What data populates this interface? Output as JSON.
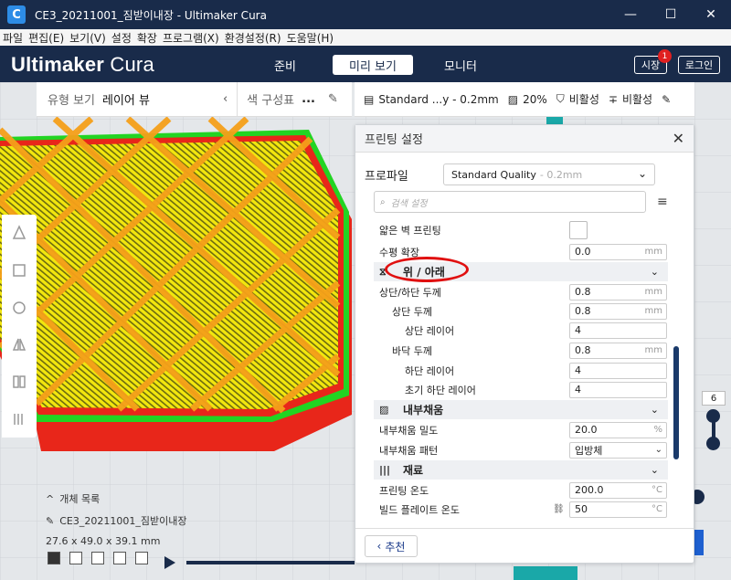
{
  "window": {
    "title": "CE3_20211001_짐받이내장 - Ultimaker Cura",
    "app_icon": "C",
    "controls": [
      "—",
      "☐",
      "✕"
    ]
  },
  "menu": [
    "파일",
    "편집(E)",
    "보기(V)",
    "설정",
    "확장",
    "프로그램(X)",
    "환경설정(R)",
    "도움말(H)"
  ],
  "header": {
    "logo_main": "Ultimaker",
    "logo_sub": "Cura",
    "tabs": [
      "준비",
      "미리 보기",
      "모니터"
    ],
    "active_tab": "미리 보기",
    "marketplace_label": "시장",
    "marketplace_badge": "1",
    "login_label": "로그인"
  },
  "viewbar": {
    "view_type_label": "유형 보기",
    "view_type_value": "레이어 뷰",
    "color_scheme_label": "색 구성표",
    "color_scheme_value": "..."
  },
  "printbar": {
    "profile": "Standard ...y - 0.2mm",
    "infill": "20%",
    "support": "비활성",
    "adhesion": "비활성"
  },
  "panel": {
    "title": "프린팅 설정",
    "profile_label": "프로파일",
    "profile_value": "Standard Quality",
    "profile_sub": "- 0.2mm",
    "search_placeholder": "검색 설정",
    "recommend_label": "추천",
    "settings": [
      {
        "kind": "check",
        "label": "얇은 벽 프린팅",
        "indent": 0
      },
      {
        "kind": "field",
        "label": "수평 확장",
        "value": "0.0",
        "unit": "mm",
        "indent": 0
      },
      {
        "kind": "cat",
        "label": "위 / 아래",
        "icon": "⧖"
      },
      {
        "kind": "field",
        "label": "상단/하단 두께",
        "value": "0.8",
        "unit": "mm",
        "indent": 0
      },
      {
        "kind": "field",
        "label": "상단 두께",
        "value": "0.8",
        "unit": "mm",
        "indent": 1
      },
      {
        "kind": "field",
        "label": "상단 레이어",
        "value": "4",
        "unit": "",
        "indent": 2
      },
      {
        "kind": "field",
        "label": "바닥 두께",
        "value": "0.8",
        "unit": "mm",
        "indent": 1
      },
      {
        "kind": "field",
        "label": "하단 레이어",
        "value": "4",
        "unit": "",
        "indent": 2
      },
      {
        "kind": "field",
        "label": "초기 하단 레이어",
        "value": "4",
        "unit": "",
        "indent": 2
      },
      {
        "kind": "cat",
        "label": "내부채움",
        "icon": "▨"
      },
      {
        "kind": "field",
        "label": "내부채움 밀도",
        "value": "20.0",
        "unit": "%",
        "indent": 0
      },
      {
        "kind": "select",
        "label": "내부채움 패턴",
        "value": "입방체",
        "indent": 0
      },
      {
        "kind": "cat",
        "label": "재료",
        "icon": "|||"
      },
      {
        "kind": "field",
        "label": "프린팅 온도",
        "value": "200.0",
        "unit": "°C",
        "indent": 0
      },
      {
        "kind": "field",
        "label": "빌드 플레이트 온도",
        "value": "50",
        "unit": "°C",
        "indent": 0,
        "linked": true
      }
    ]
  },
  "object": {
    "list_label": "개체 목록",
    "name": "CE3_20211001_짐받이내장",
    "dimensions": "27.6 x 49.0 x 39.1 mm"
  },
  "layer": {
    "current": "6"
  },
  "colors": {
    "header": "#192b4a",
    "accent": "#2d8ce6",
    "infill_yellow": "#f2e60e",
    "lattice_orange": "#f5a01a",
    "wall_red": "#e8261a",
    "wall_green": "#22d422",
    "annotation": "#e01010"
  }
}
